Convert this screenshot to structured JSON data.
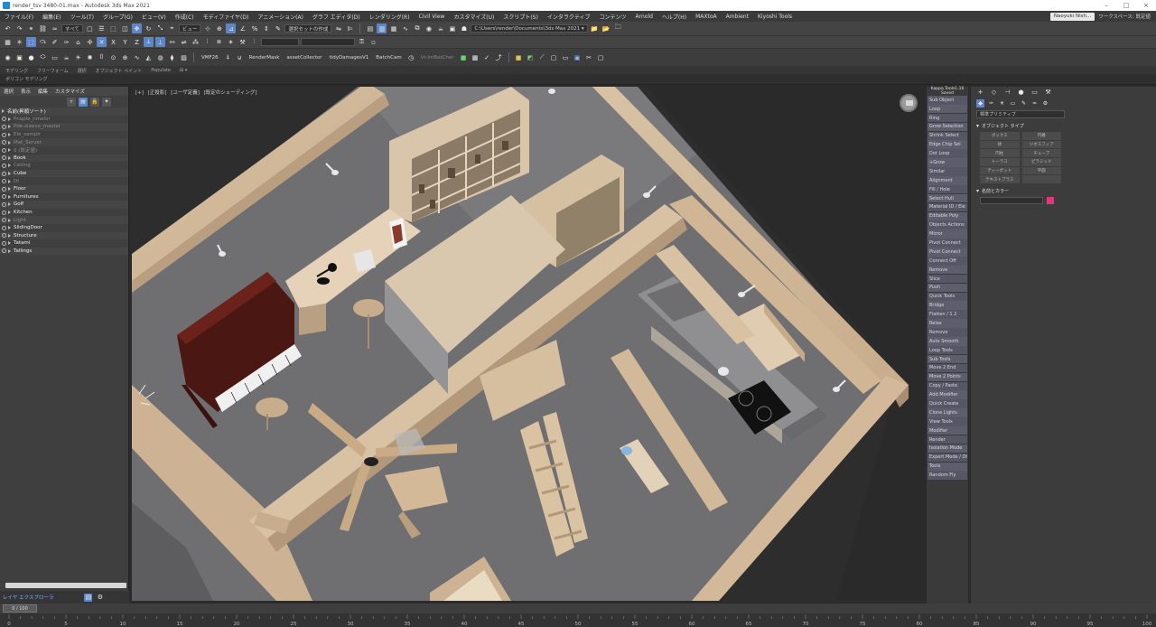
{
  "window": {
    "title": "render_tsv 3480-01.max - Autodesk 3ds Max 2021",
    "controls": [
      "–",
      "□",
      "×"
    ]
  },
  "menu": {
    "items": [
      "ファイル(F)",
      "編集(E)",
      "ツール(T)",
      "グループ(G)",
      "ビュー(V)",
      "作成(C)",
      "モディファイヤ(D)",
      "アニメーション(A)",
      "グラフ エディタ(D)",
      "レンダリング(R)",
      "Civil View",
      "カスタマイズ(U)",
      "スクリプト(S)",
      "インタラクティブ",
      "コンテンツ",
      "Arnold",
      "ヘルプ(H)"
    ],
    "extra_items": [
      "MAXtoA",
      "Ambient",
      "Kiyoshi Tools",
      "Nakagawa"
    ],
    "user": "Naoyuki Nish...",
    "workspace_label": "ワークスペース: 既定値"
  },
  "toolbar1": {
    "selection_filter": "すべて",
    "view_label": "ビュー",
    "named_selection": "選択セットの作成",
    "project_path": "C:\\Users\\render\\Documents\\3ds Max 2021 ▾"
  },
  "toolbar3": {
    "labels": [
      "VMF26",
      "RenderMask",
      "assetCollector",
      "tidyDamagesV1",
      "BatchCam",
      "Vr-lmBatCher"
    ]
  },
  "ribbon": {
    "tabs": [
      "モデリング",
      "フリーフォーム",
      "選択",
      "オブジェクト ペイント",
      "Populate",
      "⊞ ▾"
    ],
    "sub": "ポリゴン モデリング"
  },
  "scene_explorer": {
    "tabs": [
      "選択",
      "表示",
      "編集",
      "カスタマイズ"
    ],
    "rows": [
      {
        "label": "名前(昇順ソート)",
        "style": "bright"
      },
      {
        "label": "Pnaple_nmelor",
        "style": "dim"
      },
      {
        "label": "Pde-sleeve_master",
        "style": "dim"
      },
      {
        "label": "Ele_samplr",
        "style": "dim"
      },
      {
        "label": "Mat_Server",
        "style": "dim"
      },
      {
        "label": "0 (既定値)",
        "style": "dim"
      },
      {
        "label": "Book",
        "style": "bright"
      },
      {
        "label": "Ceiling",
        "style": "dim"
      },
      {
        "label": "Cube",
        "style": "bright"
      },
      {
        "label": "DI",
        "style": "dim"
      },
      {
        "label": "Floor",
        "style": "bright"
      },
      {
        "label": "Furnitures",
        "style": "bright"
      },
      {
        "label": "Golf",
        "style": "bright"
      },
      {
        "label": "Kitchen",
        "style": "bright"
      },
      {
        "label": "Light",
        "style": "dim"
      },
      {
        "label": "SlidingDoor",
        "style": "bright"
      },
      {
        "label": "Structure",
        "style": "bright"
      },
      {
        "label": "Tatami",
        "style": "bright"
      },
      {
        "label": "Tallings",
        "style": "bright"
      }
    ],
    "footer": "レイヤ エクスプローラ"
  },
  "viewport": {
    "labels": [
      "[+]",
      "[正投影]",
      "[ユーザ定義]",
      "[既定のシェーディング]"
    ]
  },
  "script_panel": {
    "header": [
      "Kappa Tools1.16",
      "Saved"
    ],
    "buttons": [
      "Sub Object",
      "Loop",
      "Ring",
      "Grow Selection",
      "Shrink Select",
      "Edge Chip Sel",
      "Dot Loop",
      "+Grow",
      "Similar",
      "Alignment",
      "Fill / Hole",
      "Select Hull",
      "Material ID / Ele",
      "Editable Poly",
      "Objects Actions",
      "Mirror",
      "Pivot Connect",
      "Pivot Connect",
      "Connect Off",
      "Remove",
      "Slice",
      "Push",
      "Quick Tools",
      "Bridge",
      "Flatten / 1 2",
      "Relax",
      "Remove",
      "Auto Smooth",
      "Loop Tools",
      "Sub Tools",
      "Move 2 End",
      "Move 2 Points",
      "Copy / Paste",
      "Add Modifier",
      "Quick Create",
      "Clone Lights",
      "View Tools",
      "Modifier",
      "Render",
      "Isolation Mode",
      "Expert Mode / Other",
      "Tools",
      "Random Fly"
    ]
  },
  "command_panel": {
    "category": "標準プリミティブ",
    "rollout_object_type": "オブジェクト タイプ",
    "object_types": [
      "ボックス",
      "円錐",
      "球",
      "ジオスフィア",
      "円柱",
      "チューブ",
      "トーラス",
      "ピラミッド",
      "ティーポット",
      "平面",
      "テキストプラス",
      ""
    ],
    "rollout_name_color": "名前とカラー",
    "swatch_color": "#e5337f"
  },
  "timeline": {
    "slider": "0 / 100",
    "ticks": [
      "0",
      "5",
      "10",
      "15",
      "20",
      "25",
      "30",
      "35",
      "40",
      "45",
      "50",
      "55",
      "60",
      "65",
      "70",
      "75",
      "80",
      "85",
      "90",
      "95",
      "100"
    ]
  }
}
